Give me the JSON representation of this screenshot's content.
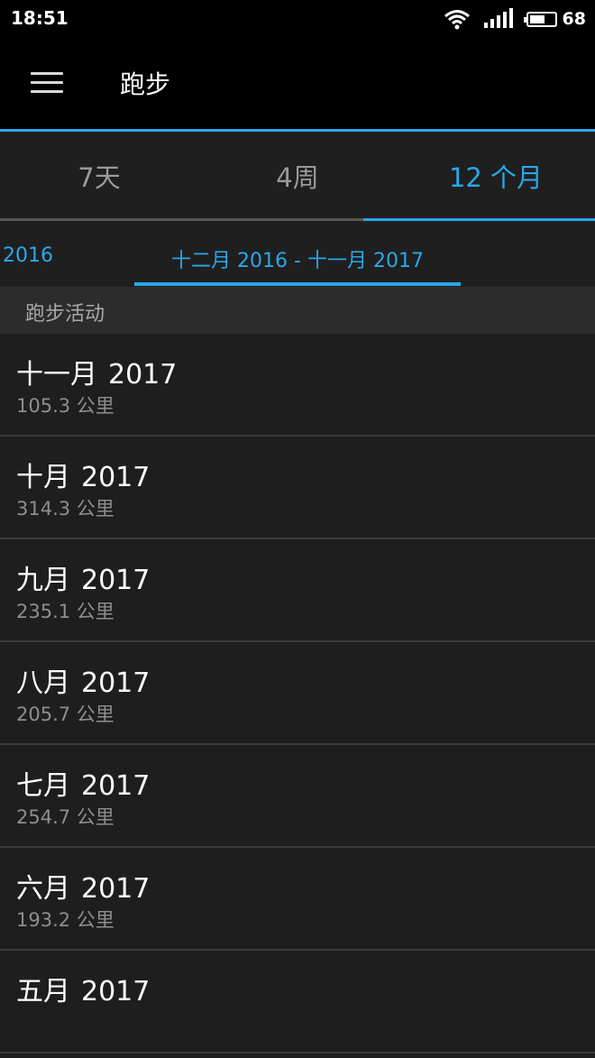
{
  "status_bar": {
    "time": "18:51",
    "battery": "68"
  },
  "app_bar": {
    "title": "跑步"
  },
  "range_tabs": [
    {
      "label": "7天",
      "active": false
    },
    {
      "label": "4周",
      "active": false
    },
    {
      "label": "12 个月",
      "active": true
    }
  ],
  "period": {
    "previous": "2016",
    "current": "十二月 2016 - 十一月 2017"
  },
  "section": {
    "title": "跑步活动"
  },
  "items": [
    {
      "month": "十一月",
      "year": "2017",
      "distance": "105.3 公里"
    },
    {
      "month": "十月",
      "year": "2017",
      "distance": "314.3 公里"
    },
    {
      "month": "九月",
      "year": "2017",
      "distance": "235.1 公里"
    },
    {
      "month": "八月",
      "year": "2017",
      "distance": "205.7 公里"
    },
    {
      "month": "七月",
      "year": "2017",
      "distance": "254.7 公里"
    },
    {
      "month": "六月",
      "year": "2017",
      "distance": "193.2 公里"
    },
    {
      "month": "五月",
      "year": "2017",
      "distance": ""
    }
  ],
  "colors": {
    "accent": "#2aa7e8",
    "background": "#1e1e1e",
    "header": "#000000"
  },
  "battery_level": 0.68
}
